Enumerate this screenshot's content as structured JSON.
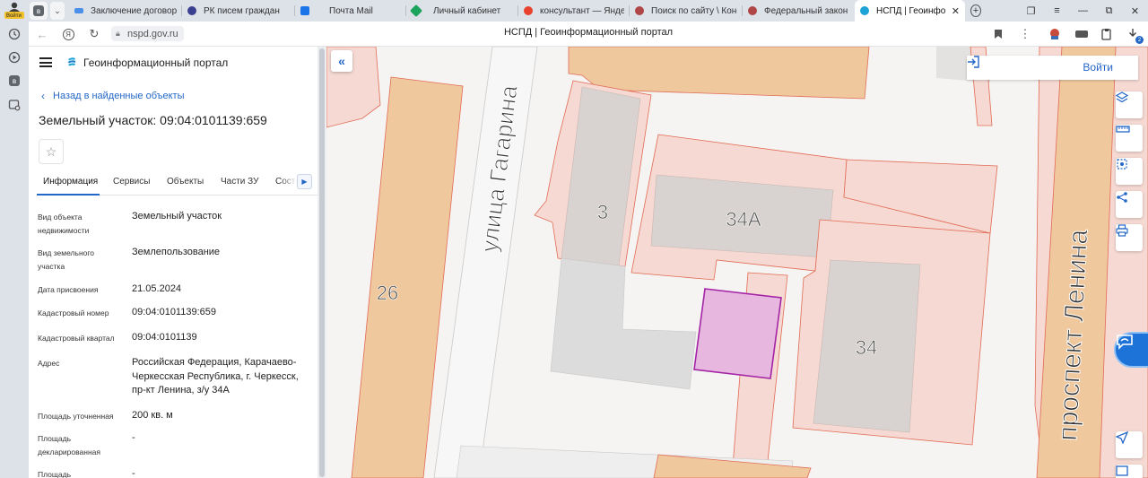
{
  "browser": {
    "profile_label": "Войти",
    "tabs": [
      {
        "title": "Заключение договоров",
        "active": false,
        "icon_color": "#4c8fe8"
      },
      {
        "title": "РК писем граждан",
        "active": false,
        "icon_color": "#3a3f8f"
      },
      {
        "title": "Почта Mail",
        "active": false,
        "icon_color": "#1b75e8"
      },
      {
        "title": "Личный кабинет",
        "active": false,
        "icon_color": "#1ca35e"
      },
      {
        "title": "консультант — Яндекс",
        "active": false,
        "icon_color": "#e8412c"
      },
      {
        "title": "Поиск по сайту \\ Консу",
        "active": false,
        "icon_color": "#b04545"
      },
      {
        "title": "Федеральный закон \"О",
        "active": false,
        "icon_color": "#b04545"
      },
      {
        "title": "НСПД | Геоинформа",
        "active": true,
        "icon_color": "#1ea3d8"
      }
    ],
    "new_tab": "+",
    "url": "nspd.gov.ru",
    "page_title": "НСПД | Геоинформационный портал",
    "download_badge": "2"
  },
  "panel": {
    "portal_name": "Геоинформационный портал",
    "back_link": "Назад в найденные объекты",
    "object_title": "Земельный участок: 09:04:0101139:659",
    "tabs": [
      "Информация",
      "Сервисы",
      "Объекты",
      "Части ЗУ",
      "Состав"
    ],
    "active_tab": "Информация",
    "properties": [
      {
        "label": "Вид объекта недвижимости",
        "value": "Земельный участок"
      },
      {
        "label": "Вид земельного участка",
        "value": "Землепользование"
      },
      {
        "label": "Дата присвоения",
        "value": "21.05.2024"
      },
      {
        "label": "Кадастровый номер",
        "value": "09:04:0101139:659"
      },
      {
        "label": "Кадастровый квартал",
        "value": "09:04:0101139"
      },
      {
        "label": "Адрес",
        "value": "Российская Федерация, Карачаево-Черкесская Республика, г. Черкесск, пр-кт Ленина, з/у 34А"
      },
      {
        "label": "Площадь уточненная",
        "value": "200 кв. м"
      },
      {
        "label": "Площадь декларированная",
        "value": "-"
      },
      {
        "label": "Площадь",
        "value": "-"
      }
    ]
  },
  "map": {
    "login_label": "Войти",
    "street_left": "улица Гагарина",
    "street_right": "проспект Ленина",
    "building_labels": [
      "26",
      "3",
      "34А",
      "34"
    ],
    "colors": {
      "accent": "#2467c7",
      "parcel_fill": "#f5d9d2",
      "parcel_stroke": "#e26b55",
      "building_fill": "#d8d3d0",
      "road_fill": "#f0c89e",
      "selected_fill": "#e7b7df",
      "selected_stroke": "#a324a6"
    }
  }
}
